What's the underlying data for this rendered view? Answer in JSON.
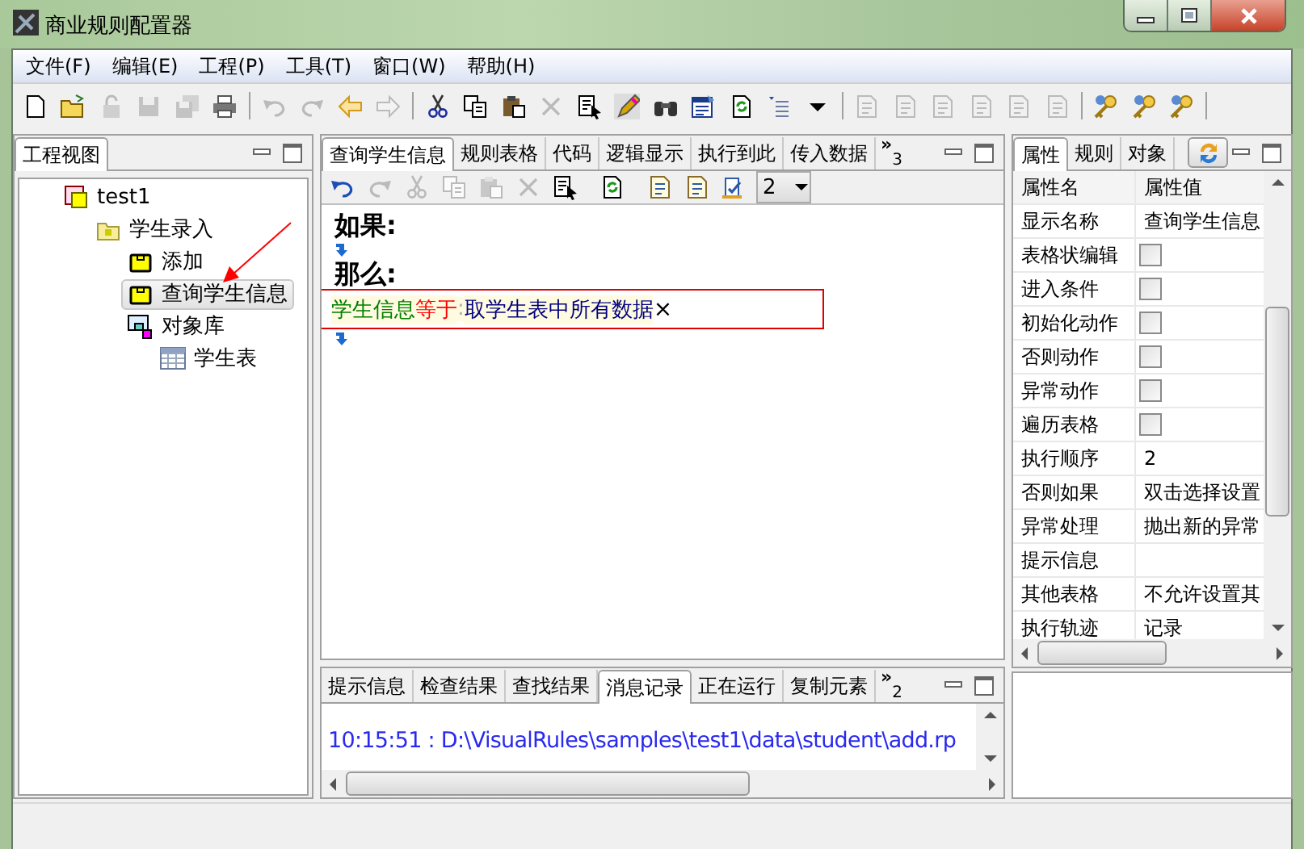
{
  "window": {
    "title": "商业规则配置器"
  },
  "menu": [
    "文件(F)",
    "编辑(E)",
    "工程(P)",
    "工具(T)",
    "窗口(W)",
    "帮助(H)"
  ],
  "toolbar": [
    {
      "kind": "new",
      "disabled": false
    },
    {
      "kind": "open",
      "disabled": false
    },
    {
      "kind": "lock",
      "disabled": true
    },
    {
      "kind": "save",
      "disabled": true
    },
    {
      "kind": "saveall",
      "disabled": true
    },
    {
      "kind": "print",
      "disabled": false
    },
    {
      "kind": "separator"
    },
    {
      "kind": "undo",
      "disabled": true
    },
    {
      "kind": "redo",
      "disabled": true
    },
    {
      "kind": "back",
      "disabled": false
    },
    {
      "kind": "forward",
      "disabled": true
    },
    {
      "kind": "separator"
    },
    {
      "kind": "cut",
      "disabled": false
    },
    {
      "kind": "copy",
      "disabled": false
    },
    {
      "kind": "paste",
      "disabled": false
    },
    {
      "kind": "delete",
      "disabled": true
    },
    {
      "kind": "select",
      "disabled": false
    },
    {
      "kind": "wand",
      "disabled": false
    },
    {
      "kind": "find",
      "disabled": false
    },
    {
      "kind": "form",
      "disabled": false
    },
    {
      "kind": "refresh",
      "disabled": false
    },
    {
      "kind": "indent",
      "disabled": false
    },
    {
      "kind": "caret",
      "disabled": false
    },
    {
      "kind": "separator"
    },
    {
      "kind": "doc",
      "disabled": true
    },
    {
      "kind": "doc",
      "disabled": true
    },
    {
      "kind": "doc",
      "disabled": true
    },
    {
      "kind": "doc",
      "disabled": true
    },
    {
      "kind": "doc",
      "disabled": true
    },
    {
      "kind": "doc",
      "disabled": true
    },
    {
      "kind": "separator"
    },
    {
      "kind": "key",
      "disabled": false
    },
    {
      "kind": "key",
      "disabled": false
    },
    {
      "kind": "key",
      "disabled": false
    },
    {
      "kind": "separator"
    }
  ],
  "project_view": {
    "tabs": [
      {
        "label": "工程视图",
        "selected": true
      }
    ],
    "tree": [
      {
        "label": "test1",
        "kind": "project",
        "selected": false,
        "children": [
          {
            "label": "学生录入",
            "kind": "folder",
            "selected": false,
            "children": [
              {
                "label": "添加",
                "kind": "rule",
                "selected": false
              },
              {
                "label": "查询学生信息",
                "kind": "rule",
                "selected": true
              },
              {
                "label": "对象库",
                "kind": "library",
                "selected": false,
                "children": [
                  {
                    "label": "学生表",
                    "kind": "table",
                    "selected": false
                  }
                ]
              }
            ]
          }
        ]
      }
    ],
    "annotation": {
      "kind": "arrow"
    }
  },
  "editor": {
    "tabs": [
      {
        "label": "查询学生信息",
        "selected": true
      },
      {
        "label": "规则表格",
        "selected": false
      },
      {
        "label": "代码",
        "selected": false
      },
      {
        "label": "逻辑显示",
        "selected": false
      },
      {
        "label": "执行到此",
        "selected": false
      },
      {
        "label": "传入数据",
        "selected": false
      }
    ],
    "overflow": {
      "glyph": "»",
      "count": "3"
    },
    "toolbar": [
      {
        "kind": "undo",
        "disabled": false
      },
      {
        "kind": "redo",
        "disabled": true
      },
      {
        "kind": "cut",
        "disabled": true
      },
      {
        "kind": "copy",
        "disabled": true
      },
      {
        "kind": "paste",
        "disabled": true
      },
      {
        "kind": "delete",
        "disabled": true
      },
      {
        "kind": "select",
        "disabled": false
      },
      {
        "kind": "spacer"
      },
      {
        "kind": "refresh",
        "disabled": false
      },
      {
        "kind": "spacer"
      },
      {
        "kind": "doc",
        "disabled": false
      },
      {
        "kind": "doc",
        "disabled": false
      },
      {
        "kind": "check",
        "disabled": false
      }
    ],
    "page_select": {
      "value": "2"
    },
    "if_label": "如果:",
    "then_label": "那么:",
    "rule": {
      "parts": [
        {
          "text": "学生信息",
          "color": "#008000"
        },
        {
          "text": "等于",
          "color": "#ff0000"
        },
        {
          "text": ":",
          "color": "#b0b0b0"
        },
        {
          "text": "取学生表中所有数据",
          "color": "#000080"
        }
      ],
      "remove": "×"
    }
  },
  "messages": {
    "tabs": [
      {
        "label": "提示信息",
        "selected": false
      },
      {
        "label": "检查结果",
        "selected": false
      },
      {
        "label": "查找结果",
        "selected": false
      },
      {
        "label": "消息记录",
        "selected": true
      },
      {
        "label": "正在运行",
        "selected": false
      },
      {
        "label": "复制元素",
        "selected": false
      }
    ],
    "overflow": {
      "glyph": "»",
      "count": "2"
    },
    "lines": [
      "10:15:51 : D:\\VisualRules\\samples\\test1\\data\\student\\add.rp"
    ]
  },
  "properties": {
    "tabs": [
      {
        "label": "属性",
        "selected": true
      },
      {
        "label": "规则",
        "selected": false
      },
      {
        "label": "对象",
        "selected": false
      }
    ],
    "columns": [
      "属性名",
      "属性值"
    ],
    "rows": [
      {
        "name": "显示名称",
        "kind": "text",
        "value": "查询学生信息"
      },
      {
        "name": "表格状编辑",
        "kind": "checkbox",
        "checked": false
      },
      {
        "name": "进入条件",
        "kind": "checkbox",
        "checked": false
      },
      {
        "name": "初始化动作",
        "kind": "checkbox",
        "checked": false
      },
      {
        "name": "否则动作",
        "kind": "checkbox",
        "checked": false
      },
      {
        "name": "异常动作",
        "kind": "checkbox",
        "checked": false
      },
      {
        "name": "遍历表格",
        "kind": "checkbox",
        "checked": false
      },
      {
        "name": "执行顺序",
        "kind": "text",
        "value": "2"
      },
      {
        "name": "否则如果",
        "kind": "text",
        "value": "双击选择设置"
      },
      {
        "name": "异常处理",
        "kind": "text",
        "value": "抛出新的异常"
      },
      {
        "name": "提示信息",
        "kind": "text",
        "value": ""
      },
      {
        "name": "其他表格",
        "kind": "text",
        "value": "不允许设置其"
      },
      {
        "name": "执行轨迹",
        "kind": "text",
        "value": "记录"
      }
    ]
  }
}
